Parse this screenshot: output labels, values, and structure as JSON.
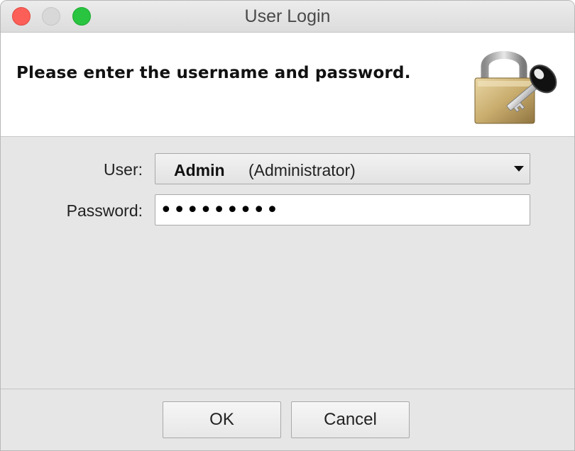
{
  "window": {
    "title": "User Login"
  },
  "header": {
    "message": "Please enter the username and password.",
    "icon": "lock-key-icon"
  },
  "form": {
    "user_label": "User:",
    "user_selected_name": "Admin",
    "user_selected_role": "(Administrator)",
    "password_label": "Password:",
    "password_value": "•••••••••"
  },
  "buttons": {
    "ok_label": "OK",
    "cancel_label": "Cancel"
  },
  "colors": {
    "close": "#fc5f57",
    "minimize": "#d8d8d8",
    "maximize": "#29c440"
  }
}
